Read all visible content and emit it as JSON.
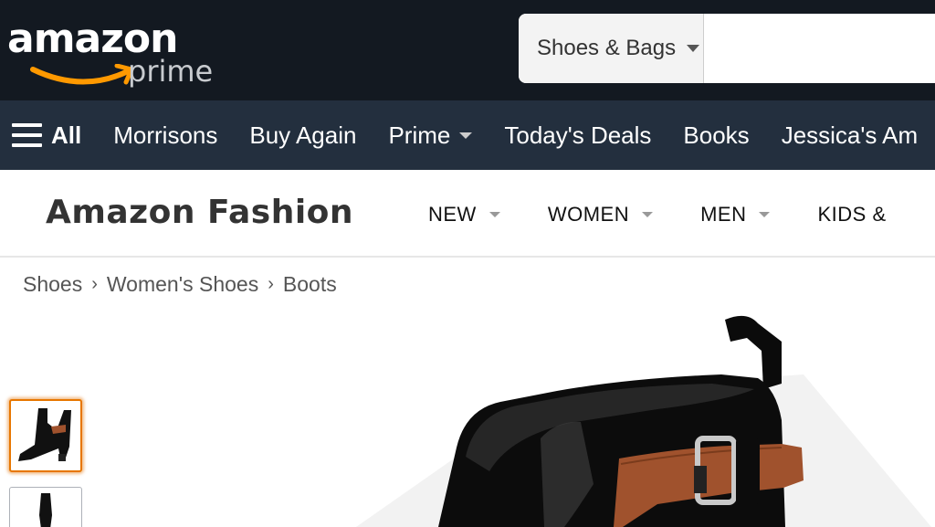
{
  "header": {
    "logo": {
      "word": "amazon",
      "tagline": "prime"
    },
    "search": {
      "department": "Shoes & Bags",
      "value": "",
      "placeholder": ""
    }
  },
  "nav": {
    "all_label": "All",
    "items": [
      {
        "label": "Morrisons"
      },
      {
        "label": "Buy Again"
      },
      {
        "label": "Prime"
      },
      {
        "label": "Today's Deals"
      },
      {
        "label": "Books"
      },
      {
        "label": "Jessica's Am"
      }
    ]
  },
  "fashion": {
    "title": "Amazon Fashion",
    "menu": [
      {
        "label": "NEW"
      },
      {
        "label": "WOMEN"
      },
      {
        "label": "MEN"
      },
      {
        "label": "KIDS &"
      }
    ]
  },
  "breadcrumb": {
    "items": [
      "Shoes",
      "Women's Shoes",
      "Boots"
    ],
    "separator": "›"
  },
  "product": {
    "thumbnails": [
      {
        "icon": "boot-side-thumbnail",
        "selected": true
      },
      {
        "icon": "boot-front-thumbnail",
        "selected": false
      }
    ],
    "main_image_icon": "patent-boot-with-tan-buckle-strap"
  },
  "colors": {
    "header_bg": "#131921",
    "nav_bg": "#232f3e",
    "accent_orange": "#ff9900",
    "thumb_selected_border": "#e77600",
    "strap_tan": "#a0522d"
  }
}
